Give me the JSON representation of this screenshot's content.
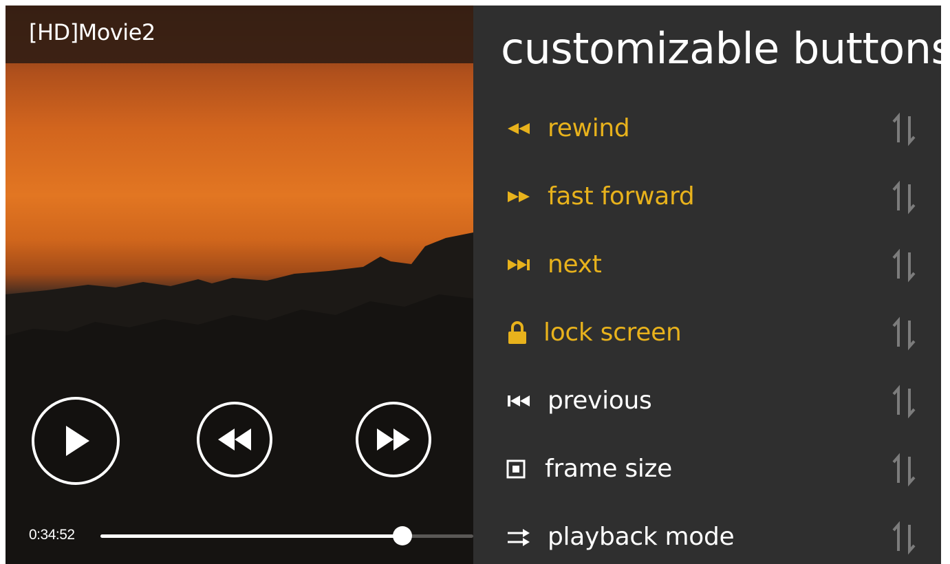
{
  "player": {
    "title": "[HD]Movie2",
    "current_time": "0:34:52",
    "progress_fraction": 0.81,
    "controls": {
      "play_icon": "play-icon",
      "rewind_icon": "rewind-icon",
      "fast_forward_icon": "fast-forward-icon"
    }
  },
  "panel": {
    "title": "customizable buttons",
    "items": [
      {
        "label": "rewind",
        "icon": "rewind-icon",
        "active": true
      },
      {
        "label": "fast forward",
        "icon": "fast-forward-icon",
        "active": true
      },
      {
        "label": "next",
        "icon": "next-icon",
        "active": true
      },
      {
        "label": "lock screen",
        "icon": "lock-icon",
        "active": true
      },
      {
        "label": "previous",
        "icon": "previous-icon",
        "active": false
      },
      {
        "label": "frame size",
        "icon": "frame-size-icon",
        "active": false
      },
      {
        "label": "playback mode",
        "icon": "playback-mode-icon",
        "active": false
      }
    ]
  },
  "colors": {
    "accent": "#e8b21c",
    "inactive": "#ffffff",
    "reorder_icon": "#7c7c7c",
    "panel_bg": "#2f2f2f"
  }
}
